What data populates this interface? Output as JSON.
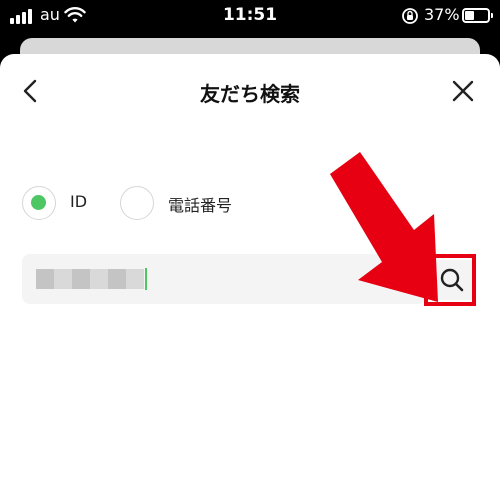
{
  "status_bar": {
    "carrier": "au",
    "time": "11:51",
    "battery_percent": "37%",
    "battery_level": 0.37,
    "icons": [
      "signal-icon",
      "wifi-icon",
      "rotation-lock-icon",
      "battery-icon"
    ]
  },
  "header": {
    "title": "友だち検索",
    "back_icon": "chevron-left-icon",
    "close_icon": "close-icon"
  },
  "search_type": {
    "options": [
      {
        "label": "ID",
        "selected": true
      },
      {
        "label": "電話番号",
        "selected": false
      }
    ]
  },
  "search": {
    "value": "",
    "value_state": "blurred/pixelated ID text",
    "clear_icon": "clear-icon",
    "button_icon": "search-icon"
  },
  "annotation": {
    "arrow_color": "#e60012",
    "highlight_color": "#e60012"
  },
  "colors": {
    "accent_green": "#4cc764",
    "annotation_red": "#e60012"
  }
}
